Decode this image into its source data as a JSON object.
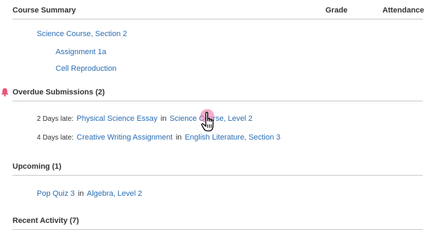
{
  "header": {
    "title": "Course Summary",
    "grade_label": "Grade",
    "attendance_label": "Attendance"
  },
  "course": {
    "name": "Science Course, Section 2",
    "items": [
      "Assignment 1a",
      "Cell Reproduction"
    ]
  },
  "overdue": {
    "title": "Overdue Submissions (2)",
    "icon": "bell-icon",
    "icon_color": "#e8577a",
    "rows": [
      {
        "late": "2 Days late:",
        "assignment": "Physical Science Essay",
        "in_text": "in",
        "course": "Science Course, Level 2"
      },
      {
        "late": "4 Days late:",
        "assignment": "Creative Writing Assignment",
        "in_text": "in",
        "course": "English Literature, Section 3"
      }
    ]
  },
  "upcoming": {
    "title": "Upcoming (1)",
    "rows": [
      {
        "assignment": "Pop Quiz 3",
        "in_text": "in",
        "course": "Algebra, Level 2"
      }
    ]
  },
  "recent": {
    "title": "Recent Activity (7)"
  },
  "colors": {
    "link": "#2a6cb2",
    "rule": "#c8c8c8",
    "cursor_highlight": "#e66ea0"
  }
}
